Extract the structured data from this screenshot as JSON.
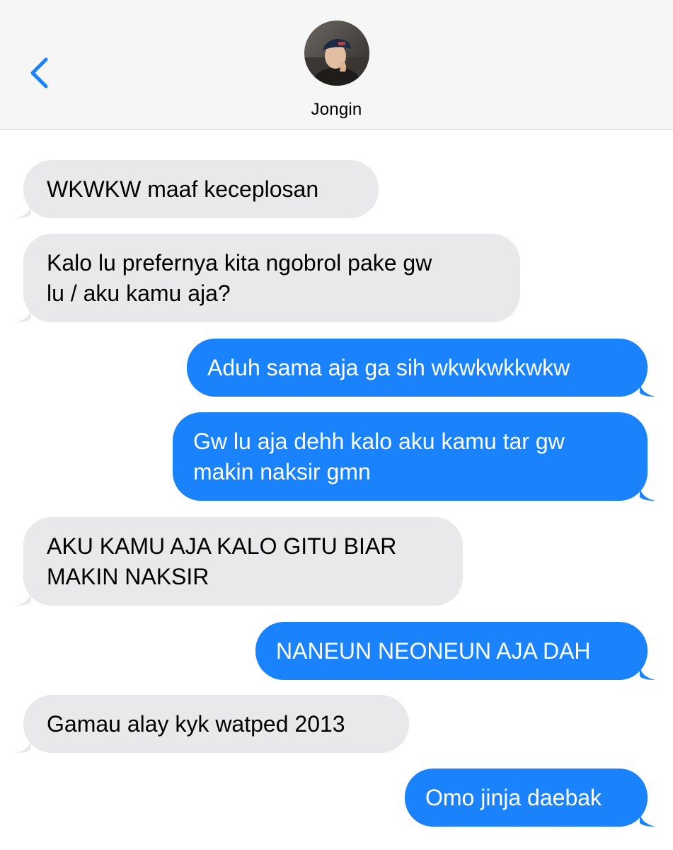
{
  "header": {
    "contact_name": "Jongin",
    "back_icon": "chevron-left-icon",
    "accent_color": "#1a82fb"
  },
  "colors": {
    "incoming_bubble": "#e9e9eb",
    "outgoing_bubble": "#1a82fb",
    "header_background": "#f6f6f6"
  },
  "messages": [
    {
      "direction": "incoming",
      "lines": [
        "WKWKW maaf keceplosan"
      ]
    },
    {
      "direction": "incoming",
      "lines": [
        "Kalo lu prefernya kita ngobrol pake gw",
        "lu / aku kamu aja?"
      ]
    },
    {
      "direction": "outgoing",
      "lines": [
        "Aduh sama aja ga sih wkwkwkkwkw"
      ]
    },
    {
      "direction": "outgoing",
      "lines": [
        "Gw lu aja dehh kalo aku kamu tar gw",
        "makin naksir gmn"
      ]
    },
    {
      "direction": "incoming",
      "lines": [
        "AKU KAMU AJA KALO GITU BIAR",
        "MAKIN NAKSIR"
      ]
    },
    {
      "direction": "outgoing",
      "lines": [
        "NANEUN NEONEUN AJA DAH"
      ]
    },
    {
      "direction": "incoming",
      "lines": [
        "Gamau alay kyk watped 2013"
      ]
    },
    {
      "direction": "outgoing",
      "lines": [
        "Omo jinja daebak"
      ]
    }
  ]
}
